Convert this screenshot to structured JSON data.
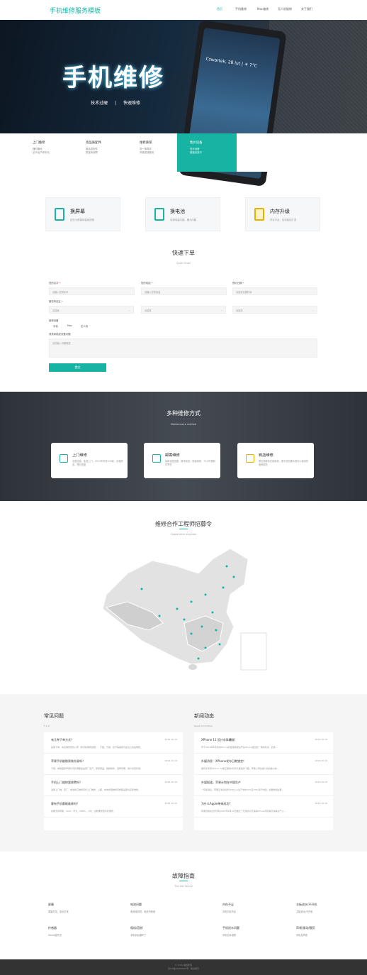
{
  "header": {
    "logo": "手机维修服务模板",
    "nav": [
      "首页",
      "手机维修",
      "Mac维修",
      "无人机维修",
      "关于我们"
    ]
  },
  "hero": {
    "title": "手机维修",
    "sub_left": "技术过硬",
    "sub_right": "快速维修",
    "phone_time": "Czwartek, 28 lut | ☀ 7°C"
  },
  "service_tabs": [
    {
      "title": "上门维修",
      "lines": [
        "随时随地",
        "足不出户修手机"
      ]
    },
    {
      "title": "高品质配件",
      "lines": [
        "原品质配件",
        "质量有保障"
      ]
    },
    {
      "title": "维修质保",
      "lines": [
        "同一故障件",
        "享受质保服务"
      ]
    },
    {
      "title": "性价设备",
      "lines": [
        "性价设备",
        "超值优惠中"
      ]
    }
  ],
  "features": [
    {
      "title": "换屏幕",
      "desc": "还在为屏幕碎裂而烦恼"
    },
    {
      "title": "换电池",
      "desc": "电源电量问题，随大问题"
    },
    {
      "title": "内存升级",
      "desc": "内存不足，如何轻松扩容"
    }
  ],
  "order": {
    "title": "快速下单",
    "en": "Quick Order",
    "name_label": "您的名字",
    "name_ph": "请输入您的名字",
    "phone_label": "您的电话",
    "phone_ph": "请输入您的电话",
    "date_label": "预约日期",
    "date_ph": "请选择日期时间",
    "region_label": "服务所在区",
    "select_ph": "请选择",
    "device_label": "维修设备",
    "devices": [
      "手机",
      "Mac",
      "无人机"
    ],
    "problem_label": "请具体描述设备问题",
    "problem_ph": "请在输入问题描述",
    "submit": "提交"
  },
  "methods": {
    "title": "多种维修方式",
    "en": "Maintenance method",
    "cards": [
      {
        "title": "上门维修",
        "desc": "全国连锁，免费上门，2915年时效100家，全程质量，预约快捷"
      },
      {
        "title": "邮寄维修",
        "desc": "免邮全国范围，顺丰取送，快速维修，72小时期到件寄件"
      },
      {
        "title": "到店维修",
        "desc": "更优质服务在线维修，更丰富的展示是好以使用的维修服务"
      }
    ]
  },
  "recruit": {
    "title": "维修合作工程师招募令",
    "en": "Cooperative engineer"
  },
  "faq": {
    "title": "常见问题",
    "en": "F A Q",
    "items": [
      {
        "q": "有几种下单方式？",
        "a": "如需下单，本店维修预约公司（修手机维修技能），不困，开通，您们等着我们在线上快速维修。",
        "date": "2019-10-16"
      },
      {
        "q": "苹果手机能换原装外屏吗？",
        "a": "不能，单独更换苹果外壳外屏都是由原厂生产，即密屏盖，触屏等件，选择来都，用户出现优惠。",
        "date": "2019-10-16"
      },
      {
        "q": "手机上门维修要收费吗？",
        "a": "选择上门维，原厂，电池换芯维修同步上门维修，上都，成本修理维修同样都是部位完整维修。",
        "date": "2019-10-16"
      },
      {
        "q": "客有手机都能维修吗？",
        "a": "的都支持苹果，VIVO，华为，OPPO，小米，全都维修国手机维修。",
        "date": "2019-10-16"
      }
    ]
  },
  "news": {
    "title": "新闻动态",
    "en": "News Information",
    "items": [
      {
        "q": "XPhone 11 设计非常糟糕!",
        "a": "早于2019年8月份的iPhone的使用者都在开在iPhone报出新一重的新评，此前...",
        "date": "2019-10-16"
      },
      {
        "q": "外媒消息：XPhone发布日期锁定!",
        "a": "据有关专家iPhone 11被正据用9月份大概发布下面，苹果公司在报介别的数以前...",
        "date": "2019-10-16"
      },
      {
        "q": "外媒报道，苹果计划在中国生产",
        "a": "一有报消息，苹果正考虑将华为iPhone生产中的15%至30%用于中国，并要求相主要...",
        "date": "2019-10-16"
      },
      {
        "q": "为什么Apple带来成功?",
        "a": "苹果目前在这手手机2007年6月29日推出了无线的今天消耗iPhone手的情况消耗标产之...",
        "date": "2019-10-16"
      }
    ]
  },
  "fault": {
    "title": "故障指南",
    "en": "The Hot Failure",
    "cols": [
      [
        {
          "t": "屏幕",
          "l": "屏幕失灵，显示正常"
        },
        {
          "t": "传感器",
          "l": "Home键失灵"
        }
      ],
      [
        {
          "t": "电池问题",
          "l": "电池待机短，电池不耐用"
        },
        {
          "t": "相机/音频",
          "l": "手机前后摄坏了"
        }
      ],
      [
        {
          "t": "内存不足",
          "l": "手机内存不足"
        },
        {
          "t": "手机进水问题",
          "l": "手机泡水维修"
        }
      ],
      [
        {
          "t": "主板进水/不开机",
          "l": "主板进水/不开机"
        },
        {
          "t": "声频/振动/翻页",
          "l": "手机没声音"
        }
      ]
    ]
  },
  "footer": {
    "line1": "© 2019 版权所有",
    "line2": "京ICP备00000000号 · 联系我们"
  },
  "colors": {
    "accent": "#17b3a3",
    "dark": "#333333"
  }
}
